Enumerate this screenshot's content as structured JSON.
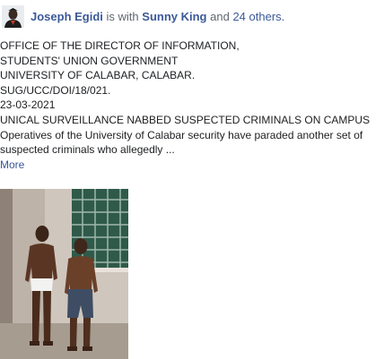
{
  "header": {
    "author": "Joseph Egidi",
    "is_with": "is with",
    "tagged": "Sunny King",
    "and": "and",
    "others": "24 others."
  },
  "post": {
    "lines": [
      "OFFICE OF THE DIRECTOR OF INFORMATION,",
      "STUDENTS' UNION GOVERNMENT",
      "UNIVERSITY OF CALABAR, CALABAR.",
      "SUG/UCC/DOI/18/021.",
      "23-03-2021",
      "UNICAL SURVEILLANCE NABBED SUSPECTED CRIMINALS ON CAMPUS"
    ],
    "body": "Operatives of the University of Calabar security have paraded another set of suspected criminals who allegedly ...",
    "more_label": "More"
  },
  "colors": {
    "link": "#3b5998",
    "text": "#1c1e21",
    "muted": "#606770"
  }
}
